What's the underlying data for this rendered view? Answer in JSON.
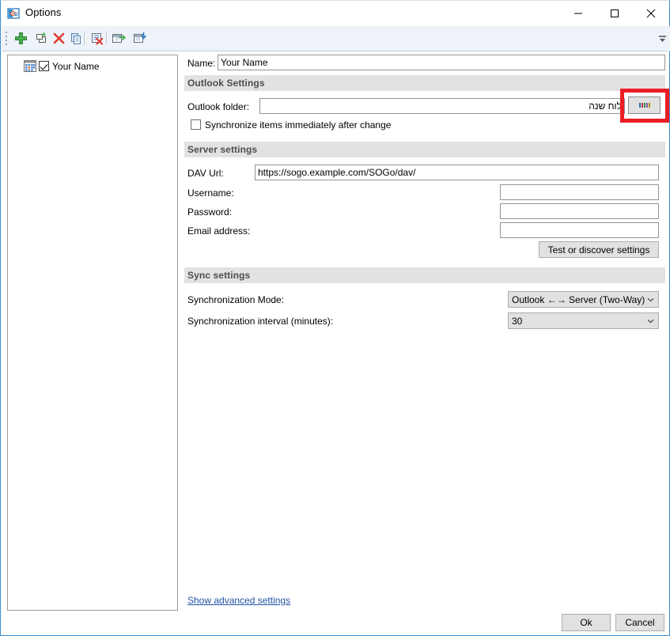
{
  "window": {
    "title": "Options",
    "icon": "app-options-icon",
    "controls": {
      "minimize": "minimize-icon",
      "maximize": "maximize-icon",
      "close": "close-icon"
    }
  },
  "toolbar": {
    "buttons": [
      {
        "name": "add-account",
        "icon": "green-plus-icon",
        "tooltip": "Add"
      },
      {
        "name": "add-folder",
        "icon": "add-folder-icon",
        "tooltip": "Add folder"
      },
      {
        "name": "delete",
        "icon": "red-x-icon",
        "tooltip": "Delete"
      },
      {
        "name": "copy",
        "icon": "copy-icon",
        "tooltip": "Copy"
      },
      {
        "name": "clear-settings",
        "icon": "clear-list-icon",
        "tooltip": "Clear"
      },
      {
        "name": "export-settings",
        "icon": "export-icon",
        "tooltip": "Export"
      },
      {
        "name": "import-settings",
        "icon": "import-icon",
        "tooltip": "Import"
      }
    ],
    "overflow": "toolbar-overflow-chevron"
  },
  "tree": {
    "items": [
      {
        "label": "Your Name",
        "checked": true,
        "icon": "calendar-icon"
      }
    ]
  },
  "form": {
    "name": {
      "label": "Name:",
      "value": "Your Name"
    },
    "outlook_section": {
      "title": "Outlook Settings",
      "folder": {
        "label": "Outlook folder:",
        "value": "לוח שנה"
      },
      "browse_button": "...",
      "sync_immediately": {
        "label": "Synchronize items immediately after change",
        "checked": false
      }
    },
    "server_section": {
      "title": "Server settings",
      "dav_url": {
        "label": "DAV Url:",
        "value": "https://sogo.example.com/SOGo/dav/"
      },
      "username": {
        "label": "Username:",
        "value": ""
      },
      "password": {
        "label": "Password:",
        "value": ""
      },
      "email": {
        "label": "Email address:",
        "value": ""
      },
      "test_button": "Test or discover settings"
    },
    "sync_section": {
      "title": "Sync settings",
      "mode": {
        "label": "Synchronization Mode:",
        "value": "Outlook ←→ Server (Two-Way)"
      },
      "interval": {
        "label": "Synchronization interval (minutes):",
        "value": "30"
      }
    }
  },
  "footer": {
    "advanced_link": "Show advanced settings",
    "ok": "Ok",
    "cancel": "Cancel"
  },
  "annotation": {
    "highlight_color": "#ed1c24",
    "target": "browse-button"
  }
}
